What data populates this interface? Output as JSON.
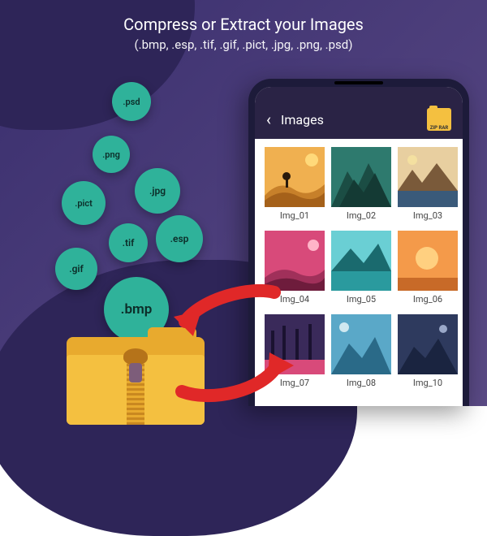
{
  "heading": {
    "title": "Compress or Extract your Images",
    "subtitle": "(.bmp, .esp, .tif, .gif, .pict, .jpg, .png, .psd)"
  },
  "bubbles": {
    "psd": ".psd",
    "png": ".png",
    "jpg": ".jpg",
    "pict": ".pict",
    "tif": ".tif",
    "esp": ".esp",
    "gif": ".gif",
    "bmp": ".bmp"
  },
  "phone": {
    "appbar_title": "Images",
    "zip_label": "ZIP RAR"
  },
  "images": [
    {
      "label": "Img_01"
    },
    {
      "label": "Img_02"
    },
    {
      "label": "Img_03"
    },
    {
      "label": "Img_04"
    },
    {
      "label": "Img_05"
    },
    {
      "label": "Img_06"
    },
    {
      "label": "Img_07"
    },
    {
      "label": "Img_08"
    },
    {
      "label": "Img_10"
    }
  ],
  "colors": {
    "accent": "#2fb29a",
    "folder": "#f4c040",
    "arrow": "#e02828"
  }
}
